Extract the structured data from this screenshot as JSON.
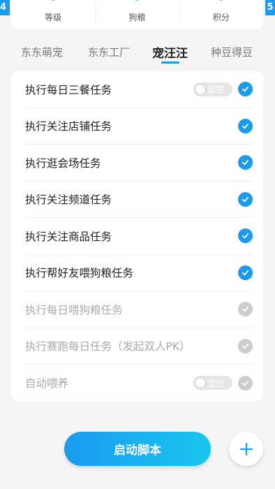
{
  "corners": {
    "left": "4",
    "right": "5"
  },
  "stats": [
    {
      "value": "-",
      "label": "等级"
    },
    {
      "value": "-",
      "label": "狗粮"
    },
    {
      "value": "-",
      "label": "积分"
    }
  ],
  "tabs": [
    {
      "label": "东东萌宠",
      "active": false
    },
    {
      "label": "东东工厂",
      "active": false
    },
    {
      "label": "宠汪汪",
      "active": true
    },
    {
      "label": "种豆得豆",
      "active": false
    }
  ],
  "tasks": [
    {
      "label": "执行每日三餐任务",
      "toggle": "监控",
      "checked": true
    },
    {
      "label": "执行关注店铺任务",
      "checked": true
    },
    {
      "label": "执行逛会场任务",
      "checked": true
    },
    {
      "label": "执行关注频道任务",
      "checked": true
    },
    {
      "label": "执行关注商品任务",
      "checked": true
    },
    {
      "label": "执行帮好友喂狗粮任务",
      "checked": true
    },
    {
      "label": "执行每日喂狗粮任务",
      "checked": false
    },
    {
      "label": "执行赛跑每日任务（发起双人PK）",
      "checked": false
    },
    {
      "label": "自动喂养",
      "toggle": "监控",
      "checked": false
    }
  ],
  "start_button": "启动脚本",
  "fab_icon": "plus-icon",
  "colors": {
    "accent": "#1a9bf0",
    "disabled": "#cccccc"
  }
}
